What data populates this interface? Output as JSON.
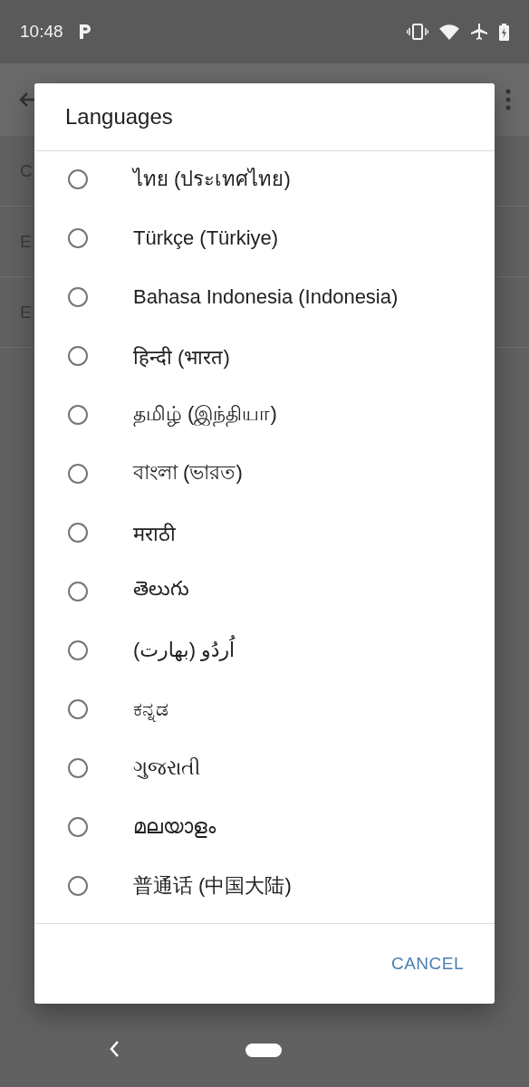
{
  "status_bar": {
    "time": "10:48"
  },
  "background": {
    "rows": [
      {
        "label": "C"
      },
      {
        "label": "E"
      },
      {
        "label": "E"
      }
    ]
  },
  "dialog": {
    "title": "Languages",
    "options": [
      {
        "label": "ไทย (ประเทศไทย)",
        "selected": false
      },
      {
        "label": "Türkçe (Türkiye)",
        "selected": false
      },
      {
        "label": "Bahasa Indonesia (Indonesia)",
        "selected": false
      },
      {
        "label": "हिन्दी (भारत)",
        "selected": false
      },
      {
        "label": "தமிழ் (இந்தியா)",
        "selected": false
      },
      {
        "label": "বাংলা (ভারত)",
        "selected": false
      },
      {
        "label": "मराठी",
        "selected": false
      },
      {
        "label": "తెలుగు",
        "selected": false
      },
      {
        "label": "اُردُو (بھارت)",
        "selected": false
      },
      {
        "label": "ಕನ್ನಡ",
        "selected": false
      },
      {
        "label": "ગુજરાતી",
        "selected": false
      },
      {
        "label": "മലയാളം",
        "selected": false
      },
      {
        "label": "普通话 (中国大陆)",
        "selected": false
      }
    ],
    "buttons": [
      "CANCEL"
    ]
  }
}
